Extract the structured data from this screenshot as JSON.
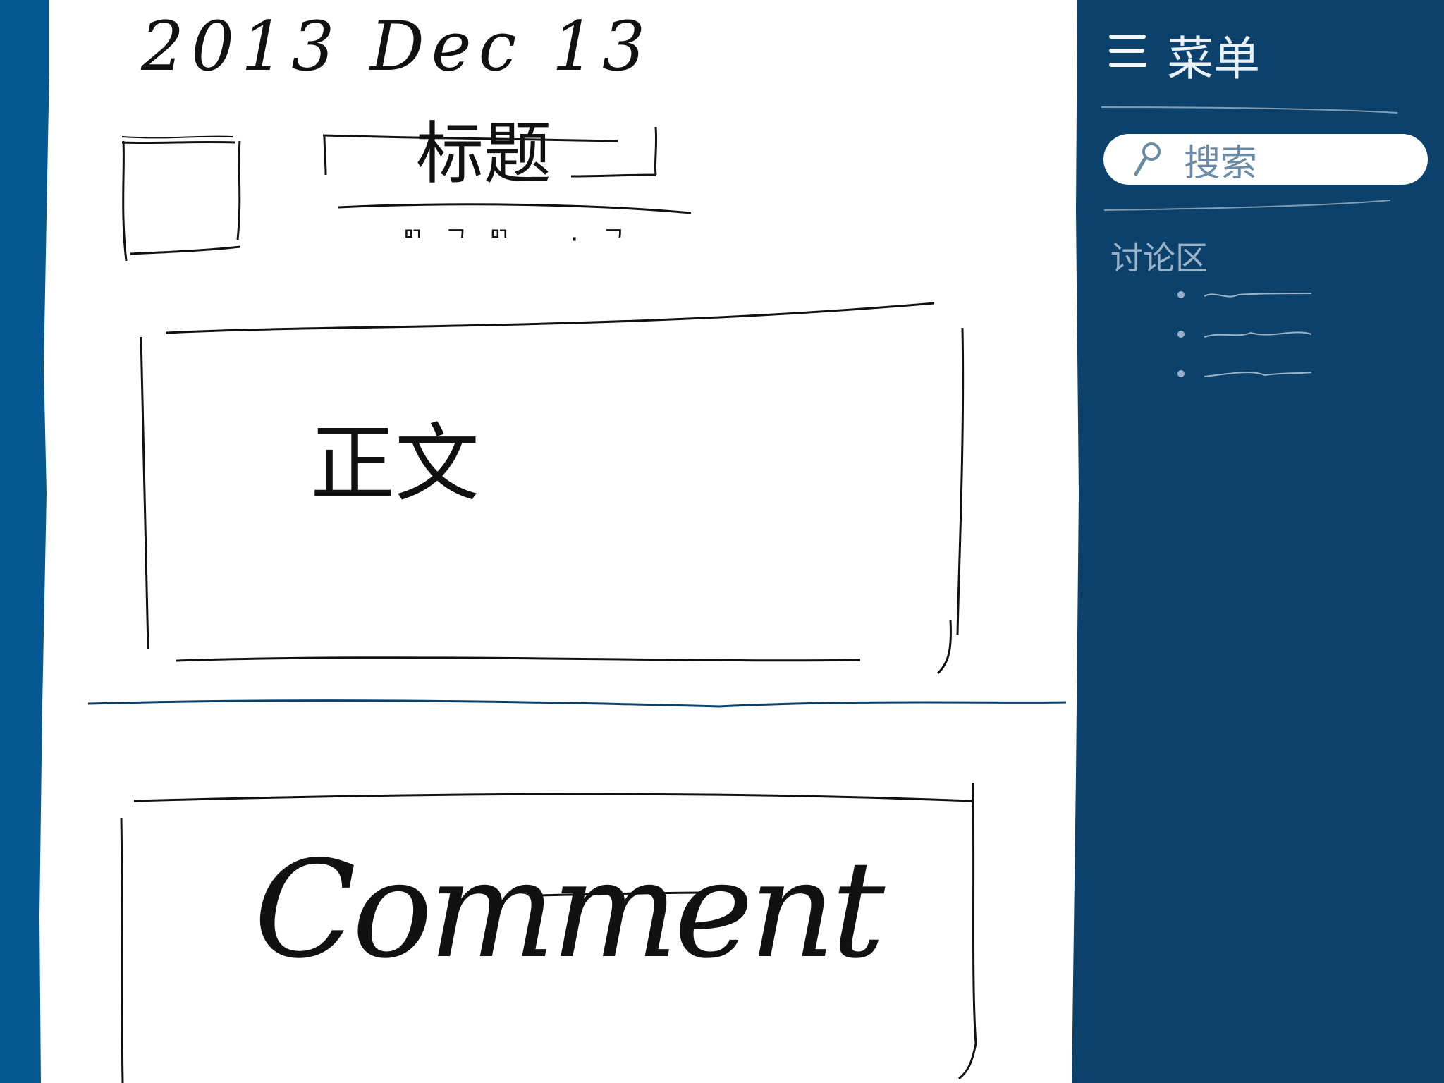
{
  "post": {
    "date": "2013 Dec 13",
    "title": "标题",
    "meta": "ᄆᄀᄀᄆᄀ ·ᄀ",
    "body": "正文",
    "comment_label": "Comment"
  },
  "sidebar": {
    "menu_label": "菜单",
    "search_placeholder": "搜索",
    "section_title": "讨论区",
    "items": [
      {
        "label": ""
      },
      {
        "label": ""
      },
      {
        "label": ""
      }
    ]
  },
  "colors": {
    "left_rail": "#065893",
    "sidebar_bg": "#0b416a",
    "ink": "#111111",
    "divider": "#0b416a"
  }
}
